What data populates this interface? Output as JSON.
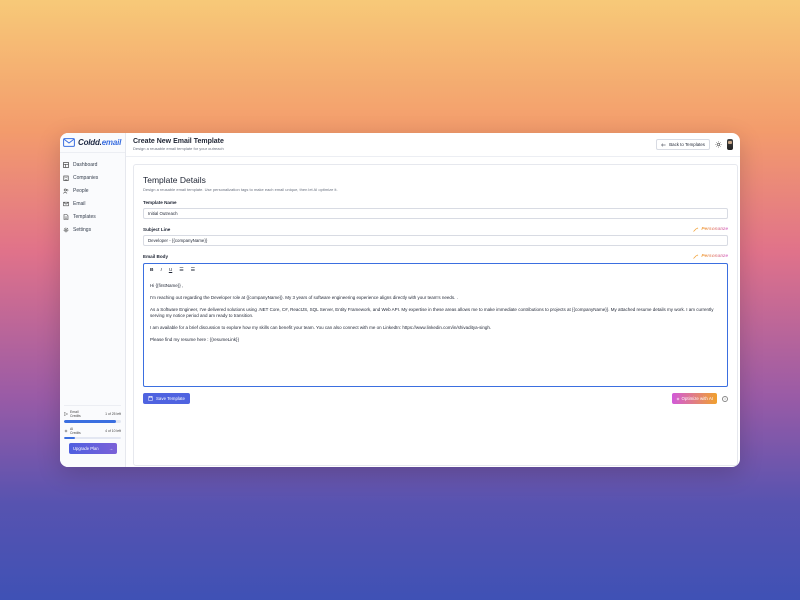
{
  "app": {
    "logo_main": "Coldd.",
    "logo_accent": "email"
  },
  "sidebar": {
    "items": [
      {
        "label": "Dashboard",
        "icon": "dashboard-icon"
      },
      {
        "label": "Companies",
        "icon": "building-icon"
      },
      {
        "label": "People",
        "icon": "users-icon"
      },
      {
        "label": "Email",
        "icon": "mail-icon"
      },
      {
        "label": "Templates",
        "icon": "file-icon"
      },
      {
        "label": "Settings",
        "icon": "gear-icon"
      }
    ],
    "credits": {
      "email_label_1": "Email",
      "email_label_2": "Credits",
      "email_value": "1 of 25 left",
      "email_fraction": 0.92,
      "ai_label_1": "AI",
      "ai_label_2": "Credits",
      "ai_value": "4 of 10 left",
      "ai_fraction": 0.2
    },
    "upgrade_label": "Upgrade Plan",
    "upgrade_arrow": "→"
  },
  "header": {
    "title": "Create New Email Template",
    "subtitle": "Design a reusable email template for your outreach",
    "back_label": "Back to Templates"
  },
  "card": {
    "title": "Template Details",
    "subtitle": "Design a reusable email template. Use personalization tags to make each email unique, then let AI optimize it.",
    "template_name_label": "Template Name",
    "template_name_value": "Initial Outreach",
    "subject_label": "Subject Line",
    "subject_value": "Developer - {{companyName}}",
    "personalize_label": "Personalize",
    "email_body_label": "Email Body",
    "toolbar": {
      "bold": "B",
      "italic": "I",
      "underline": "U",
      "bullet_list": "☰",
      "numbered_list": "☰"
    },
    "body_paragraphs": [
      "Hi {{firstName}} ,",
      "I'm reaching out regarding the Developer role at {{companyName}}. My 3 years of software engineering experience aligns directly with your team's needs. .",
      "As a Software Engineer, I've delivered solutions using .NET Core, C#, ReactJS, SQL Server, Entity Framework, and Web API. My expertise in these areas allows me to make immediate contributions to projects at {{companyName}}. My attached resume details my work. I am currently serving my notice period and am ready to transition.",
      "I am available for a brief discussion to explore how my skills can benefit your team. You can also connect with me on LinkedIn: https://www.linkedin.com/in/shivaditya-singh.",
      "Please find my resume here : {{resumeLink}}"
    ],
    "save_label": "Save Template",
    "optimize_label": "Optimize with AI",
    "info_glyph": "i"
  },
  "colors": {
    "accent": "#3b6fe0",
    "save_button": "#4f63e0",
    "optimize_gradient_start": "#d15ad9",
    "optimize_gradient_end": "#f0a12d"
  }
}
